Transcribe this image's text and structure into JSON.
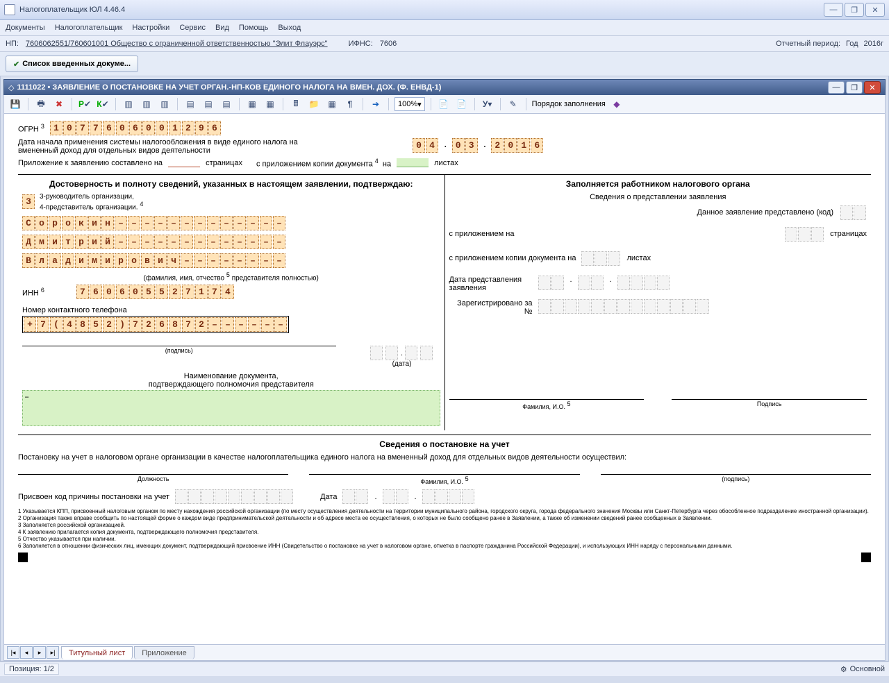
{
  "app": {
    "title": "Налогоплательщик ЮЛ 4.46.4"
  },
  "menu": [
    "Документы",
    "Налогоплательщик",
    "Настройки",
    "Сервис",
    "Вид",
    "Помощь",
    "Выход"
  ],
  "info": {
    "np_label": "НП:",
    "np_value": "7606062551/760601001 Общество с ограниченной ответственностью \"Элит Флауэрс\"",
    "ifns_label": "ИФНС:",
    "ifns_value": "7606",
    "period_label": "Отчетный период:",
    "period_kind": "Год",
    "period_year": "2016г"
  },
  "topbtn": {
    "label": "Список введенных докуме..."
  },
  "doc": {
    "title": "1111022 • ЗАЯВЛЕНИЕ О ПОСТАНОВКЕ НА УЧЕТ ОРГАН.-НП-КОВ ЕДИНОГО НАЛОГА  НА ВМЕН. ДОХ.  (Ф. ЕНВД-1)",
    "zoom": "100%",
    "order_btn": "Порядок заполнения"
  },
  "form": {
    "ogrn_label": "ОГРН",
    "ogrn_sup": "3",
    "ogrn": [
      "1",
      "0",
      "7",
      "7",
      "6",
      "0",
      "6",
      "0",
      "0",
      "1",
      "2",
      "9",
      "6"
    ],
    "start_text": "Дата начала применения системы налогообложения в виде единого налога на вмененный доход для отдельных видов деятельности",
    "date": {
      "d": [
        "0",
        "4"
      ],
      "m": [
        "0",
        "3"
      ],
      "y": [
        "2",
        "0",
        "1",
        "6"
      ]
    },
    "attach_left": "Приложение к заявлению составлено на",
    "attach_pages": "страницах",
    "attach_mid": "с приложением копии документа",
    "attach_sup": "4",
    "attach_on": "на",
    "attach_sheets": "листах",
    "left_header": "Достоверность и полноту сведений, указанных в настоящем заявлении, подтверждаю:",
    "role3": "3-руководитель организации,",
    "role4": "4-представитель организации.",
    "role4_sup": "4",
    "role_code": "3",
    "name1": [
      "С",
      "о",
      "р",
      "о",
      "к",
      "и",
      "н",
      "–",
      "–",
      "–",
      "–",
      "–",
      "–",
      "–",
      "–",
      "–",
      "–",
      "–",
      "–",
      "–"
    ],
    "name2": [
      "Д",
      "м",
      "и",
      "т",
      "р",
      "и",
      "й",
      "–",
      "–",
      "–",
      "–",
      "–",
      "–",
      "–",
      "–",
      "–",
      "–",
      "–",
      "–",
      "–"
    ],
    "name3": [
      "В",
      "л",
      "а",
      "д",
      "и",
      "м",
      "и",
      "р",
      "о",
      "в",
      "и",
      "ч",
      "–",
      "–",
      "–",
      "–",
      "–",
      "–",
      "–",
      "–"
    ],
    "fio_note": "(фамилия, имя, отчество",
    "fio_sup": "5",
    "fio_note2": "представителя полностью)",
    "inn_label": "ИНН",
    "inn_sup": "6",
    "inn": [
      "7",
      "6",
      "0",
      "6",
      "0",
      "5",
      "5",
      "2",
      "7",
      "1",
      "7",
      "4"
    ],
    "phone_label": "Номер контактного телефона",
    "phone": [
      "+",
      "7",
      "(",
      "4",
      "8",
      "5",
      "2",
      ")",
      "7",
      "2",
      "6",
      "8",
      "7",
      "2",
      "–",
      "–",
      "–",
      "–",
      "–",
      "–"
    ],
    "sign": "(подпись)",
    "date_lbl": "(дата)",
    "doc_name1": "Наименование документа,",
    "doc_name2": "подтверждающего полномочия представителя",
    "greenbox": "–",
    "right_header": "Заполняется работником налогового органа",
    "r1": "Сведения о представлении заявления",
    "r2": "Данное заявление представлено (код)",
    "r3": "с приложением на",
    "r3b": "страницах",
    "r4": "с приложением копии  документа на",
    "r4b": "листах",
    "r5": "Дата представления заявления",
    "r6": "Зарегистрировано за №",
    "rfio": "Фамилия, И.О.",
    "rfio_sup": "5",
    "rsign": "Подпись",
    "reg_header": "Сведения о постановке на учет",
    "reg_text": "Постановку на учет в налоговом органе организации в качестве налогоплательщика единого налога на вмененный доход для отдельных видов деятельности осуществил:",
    "reg_job": "Должность",
    "reg_fio": "Фамилия, И.О.",
    "reg_fio_sup": "5",
    "reg_sign": "(подпись)",
    "reg_code": "Присвоен код причины постановки на учет",
    "reg_date": "Дата",
    "footnotes": [
      "1 Указывается КПП, присвоенный налоговым органом по месту нахождения российской организации (по месту осуществления деятельности на территории муниципального района, городского округа, города федерального значения Москвы или Санкт-Петербурга через обособленное подразделение иностранной организации).",
      "2 Организация также вправе сообщить по настоящей форме о каждом виде предпринимательской деятельности и об адресе места ее осуществления, о которых не было сообщено ранее в Заявлении, а также об изменении сведений ранее сообщенных в Заявлении.",
      "3 Заполняется российской организацией.",
      "4 К заявлению прилагается копия документа, подтверждающего полномочия представителя.",
      "5 Отчество указывается при наличии.",
      "6 Заполняется в отношении физических лиц, имеющих документ, подтверждающий присвоение ИНН (Свидетельство о постановке на учет в налоговом органе, отметка в паспорте гражданина Российской Федерации), и использующих ИНН наряду с персональными данными."
    ]
  },
  "tabs": {
    "t1": "Титульный лист",
    "t2": "Приложение"
  },
  "status": {
    "pos": "Позиция: 1/2",
    "mode": "Основной"
  }
}
